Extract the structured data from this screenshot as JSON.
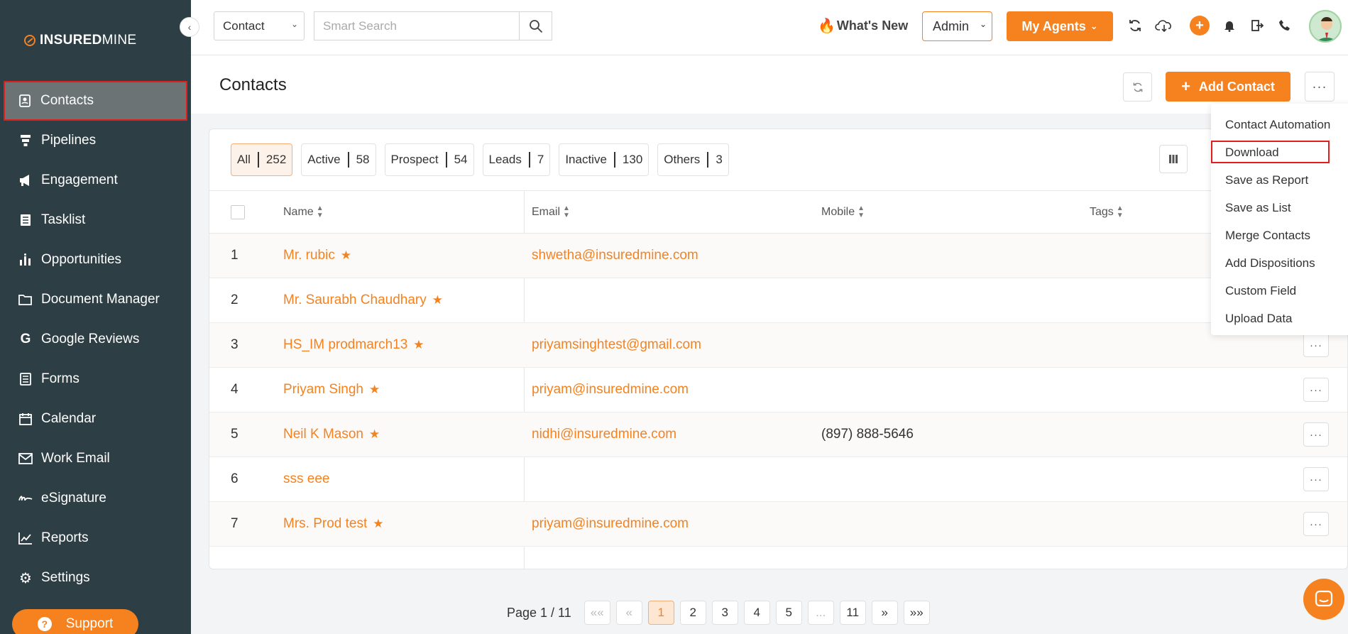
{
  "brand": {
    "bold": "INSURED",
    "light": "MINE"
  },
  "sidebar": {
    "items": [
      {
        "label": "Contacts",
        "icon": "contact-card-icon"
      },
      {
        "label": "Pipelines",
        "icon": "funnel-icon"
      },
      {
        "label": "Engagement",
        "icon": "megaphone-icon"
      },
      {
        "label": "Tasklist",
        "icon": "list-icon"
      },
      {
        "label": "Opportunities",
        "icon": "bar-chart-icon"
      },
      {
        "label": "Document Manager",
        "icon": "folder-icon"
      },
      {
        "label": "Google Reviews",
        "icon": "google-icon"
      },
      {
        "label": "Forms",
        "icon": "form-icon"
      },
      {
        "label": "Calendar",
        "icon": "calendar-icon"
      },
      {
        "label": "Work Email",
        "icon": "envelope-icon"
      },
      {
        "label": "eSignature",
        "icon": "signature-icon"
      },
      {
        "label": "Reports",
        "icon": "line-chart-icon"
      },
      {
        "label": "Settings",
        "icon": "gear-icon"
      }
    ],
    "support_label": "Support"
  },
  "topbar": {
    "search_type": "Contact",
    "search_placeholder": "Smart Search",
    "whats_new": "What's New",
    "admin": "Admin",
    "my_agents": "My Agents"
  },
  "page": {
    "title": "Contacts",
    "add_contact": "Add Contact"
  },
  "filters": [
    {
      "label": "All",
      "count": "252"
    },
    {
      "label": "Active",
      "count": "58"
    },
    {
      "label": "Prospect",
      "count": "54"
    },
    {
      "label": "Leads",
      "count": "7"
    },
    {
      "label": "Inactive",
      "count": "130"
    },
    {
      "label": "Others",
      "count": "3"
    }
  ],
  "table": {
    "headers": {
      "name": "Name",
      "email": "Email",
      "mobile": "Mobile",
      "tags": "Tags"
    },
    "rows": [
      {
        "num": "1",
        "name": "Mr. rubic",
        "star": true,
        "email": "shwetha@insuredmine.com",
        "mobile": ""
      },
      {
        "num": "2",
        "name": "Mr. Saurabh Chaudhary",
        "star": true,
        "email": "",
        "mobile": ""
      },
      {
        "num": "3",
        "name": "HS_IM prodmarch13",
        "star": true,
        "email": "priyamsinghtest@gmail.com",
        "mobile": ""
      },
      {
        "num": "4",
        "name": "Priyam Singh",
        "star": true,
        "email": "priyam@insuredmine.com",
        "mobile": ""
      },
      {
        "num": "5",
        "name": "Neil K Mason",
        "star": true,
        "email": "nidhi@insuredmine.com",
        "mobile": "(897) 888-5646"
      },
      {
        "num": "6",
        "name": "sss eee",
        "star": false,
        "email": "",
        "mobile": ""
      },
      {
        "num": "7",
        "name": "Mrs. Prod test",
        "star": true,
        "email": "priyam@insuredmine.com",
        "mobile": ""
      }
    ]
  },
  "dropdown": {
    "items": [
      "Contact Automation",
      "Download",
      "Save as Report",
      "Save as List",
      "Merge Contacts",
      "Add Dispositions",
      "Custom Field",
      "Upload Data"
    ]
  },
  "pagination": {
    "label": "Page 1 / 11",
    "first": "««",
    "prev": "«",
    "pages": [
      "1",
      "2",
      "3",
      "4",
      "5",
      "...",
      "11"
    ],
    "next": "»",
    "last": "»»"
  },
  "colors": {
    "accent": "#f5821f",
    "sidebar": "#2d3e44",
    "highlight_border": "#e01e1e"
  }
}
